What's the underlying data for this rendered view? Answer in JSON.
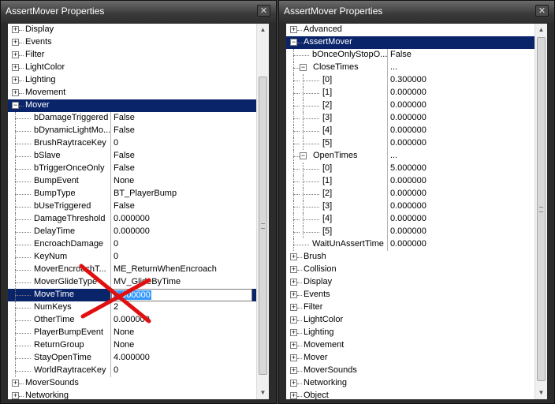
{
  "left": {
    "title": "AssertMover Properties",
    "close": "✕",
    "rows": [
      {
        "label": "Display",
        "kind": "cat",
        "pm": "+"
      },
      {
        "label": "Events",
        "kind": "cat",
        "pm": "+"
      },
      {
        "label": "Filter",
        "kind": "cat",
        "pm": "+"
      },
      {
        "label": "LightColor",
        "kind": "cat",
        "pm": "+"
      },
      {
        "label": "Lighting",
        "kind": "cat",
        "pm": "+"
      },
      {
        "label": "Movement",
        "kind": "cat",
        "pm": "+"
      },
      {
        "label": "Mover",
        "kind": "cat",
        "pm": "−",
        "selected": true
      },
      {
        "label": "bDamageTriggered",
        "value": "False",
        "kind": "prop"
      },
      {
        "label": "bDynamicLightMo...",
        "value": "False",
        "kind": "prop"
      },
      {
        "label": "BrushRaytraceKey",
        "value": "0",
        "kind": "prop"
      },
      {
        "label": "bSlave",
        "value": "False",
        "kind": "prop"
      },
      {
        "label": "bTriggerOnceOnly",
        "value": "False",
        "kind": "prop"
      },
      {
        "label": "BumpEvent",
        "value": "None",
        "kind": "prop"
      },
      {
        "label": "BumpType",
        "value": "BT_PlayerBump",
        "kind": "prop"
      },
      {
        "label": "bUseTriggered",
        "value": "False",
        "kind": "prop"
      },
      {
        "label": "DamageThreshold",
        "value": "0.000000",
        "kind": "prop"
      },
      {
        "label": "DelayTime",
        "value": "0.000000",
        "kind": "prop"
      },
      {
        "label": "EncroachDamage",
        "value": "0",
        "kind": "prop"
      },
      {
        "label": "KeyNum",
        "value": "0",
        "kind": "prop"
      },
      {
        "label": "MoverEncroachT...",
        "value": "ME_ReturnWhenEncroach",
        "kind": "prop"
      },
      {
        "label": "MoverGlideType",
        "value": "MV_GlideByTime",
        "kind": "prop"
      },
      {
        "label": "MoveTime",
        "value": "1.000000",
        "kind": "prop",
        "editing": true
      },
      {
        "label": "NumKeys",
        "value": "2",
        "kind": "prop"
      },
      {
        "label": "OtherTime",
        "value": "0.000000",
        "kind": "prop"
      },
      {
        "label": "PlayerBumpEvent",
        "value": "None",
        "kind": "prop"
      },
      {
        "label": "ReturnGroup",
        "value": "None",
        "kind": "prop"
      },
      {
        "label": "StayOpenTime",
        "value": "4.000000",
        "kind": "prop"
      },
      {
        "label": "WorldRaytraceKey",
        "value": "0",
        "kind": "prop"
      },
      {
        "label": "MoverSounds",
        "kind": "cat",
        "pm": "+"
      },
      {
        "label": "Networking",
        "kind": "cat",
        "pm": "+"
      }
    ]
  },
  "right": {
    "title": "AssertMover Properties",
    "close": "✕",
    "rows": [
      {
        "label": "Advanced",
        "kind": "cat",
        "pm": "+"
      },
      {
        "label": "AssertMover",
        "kind": "cat",
        "pm": "−",
        "selected": true
      },
      {
        "label": "bOnceOnlyStopO...",
        "value": "False",
        "kind": "prop"
      },
      {
        "label": "CloseTimes",
        "value": "...",
        "kind": "arr",
        "pm": "−"
      },
      {
        "label": "[0]",
        "value": "0.300000",
        "kind": "elem"
      },
      {
        "label": "[1]",
        "value": "0.000000",
        "kind": "elem"
      },
      {
        "label": "[2]",
        "value": "0.000000",
        "kind": "elem"
      },
      {
        "label": "[3]",
        "value": "0.000000",
        "kind": "elem"
      },
      {
        "label": "[4]",
        "value": "0.000000",
        "kind": "elem"
      },
      {
        "label": "[5]",
        "value": "0.000000",
        "kind": "elem"
      },
      {
        "label": "OpenTimes",
        "value": "...",
        "kind": "arr",
        "pm": "−"
      },
      {
        "label": "[0]",
        "value": "5.000000",
        "kind": "elem"
      },
      {
        "label": "[1]",
        "value": "0.000000",
        "kind": "elem"
      },
      {
        "label": "[2]",
        "value": "0.000000",
        "kind": "elem"
      },
      {
        "label": "[3]",
        "value": "0.000000",
        "kind": "elem"
      },
      {
        "label": "[4]",
        "value": "0.000000",
        "kind": "elem"
      },
      {
        "label": "[5]",
        "value": "0.000000",
        "kind": "elem"
      },
      {
        "label": "WaitUnAssertTime",
        "value": "0.000000",
        "kind": "prop"
      },
      {
        "label": "Brush",
        "kind": "cat",
        "pm": "+"
      },
      {
        "label": "Collision",
        "kind": "cat",
        "pm": "+"
      },
      {
        "label": "Display",
        "kind": "cat",
        "pm": "+"
      },
      {
        "label": "Events",
        "kind": "cat",
        "pm": "+"
      },
      {
        "label": "Filter",
        "kind": "cat",
        "pm": "+"
      },
      {
        "label": "LightColor",
        "kind": "cat",
        "pm": "+"
      },
      {
        "label": "Lighting",
        "kind": "cat",
        "pm": "+"
      },
      {
        "label": "Movement",
        "kind": "cat",
        "pm": "+"
      },
      {
        "label": "Mover",
        "kind": "cat",
        "pm": "+"
      },
      {
        "label": "MoverSounds",
        "kind": "cat",
        "pm": "+"
      },
      {
        "label": "Networking",
        "kind": "cat",
        "pm": "+"
      },
      {
        "label": "Object",
        "kind": "cat",
        "pm": "+"
      }
    ]
  },
  "scroll": {
    "up": "▲",
    "down": "▼"
  },
  "overlay": {
    "mark": "red-x",
    "color": "#e01010"
  }
}
